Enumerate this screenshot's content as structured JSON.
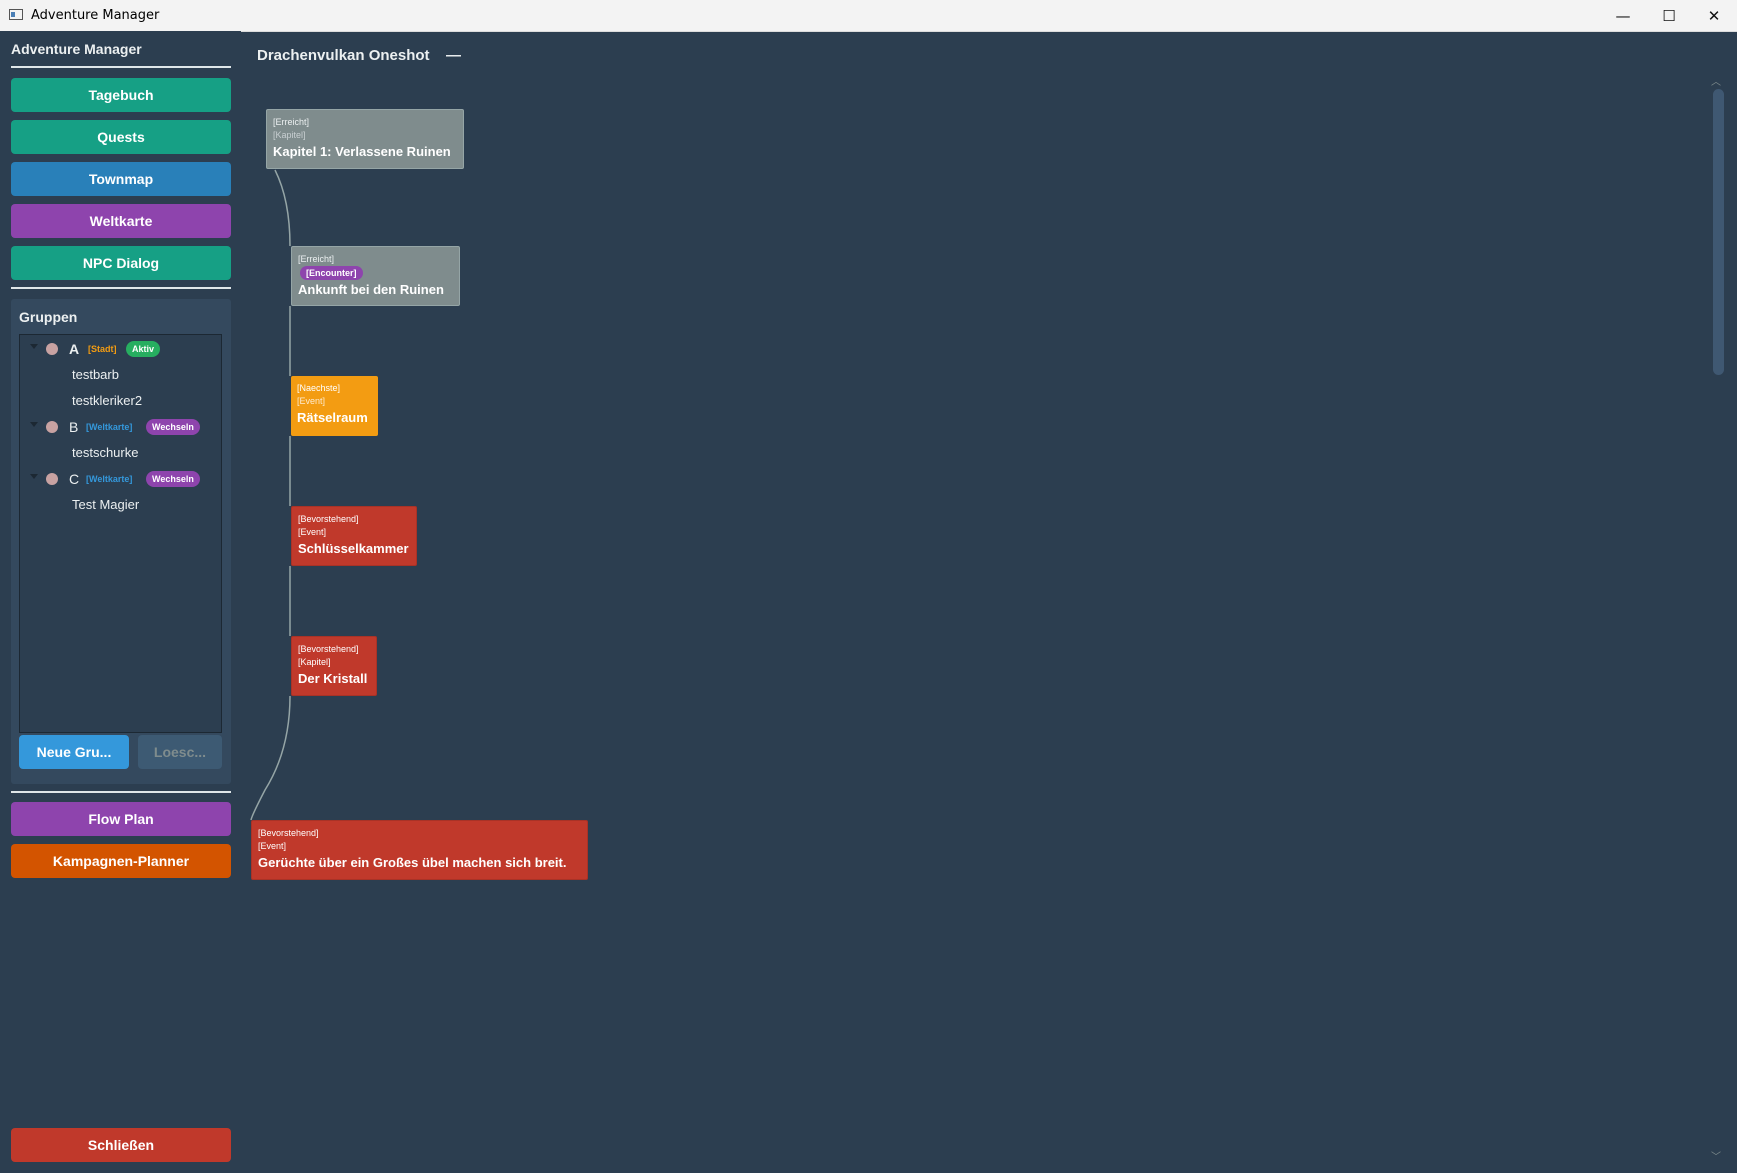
{
  "window": {
    "title": "Adventure Manager",
    "minimize_glyph": "—",
    "maximize_glyph": "☐",
    "close_glyph": "✕"
  },
  "sidebar": {
    "title": "Adventure Manager",
    "nav": [
      {
        "label": "Tagebuch",
        "color": "#16a085"
      },
      {
        "label": "Quests",
        "color": "#16a085"
      },
      {
        "label": "Townmap",
        "color": "#2980b9"
      },
      {
        "label": "Weltkarte",
        "color": "#8e44ad"
      },
      {
        "label": "NPC Dialog",
        "color": "#16a085"
      }
    ],
    "groups": {
      "title": "Gruppen",
      "items": [
        {
          "name": "A",
          "location": "[Stadt]",
          "badge": "Aktiv",
          "members": [
            "testbarb",
            "testkleriker2"
          ]
        },
        {
          "name": "B",
          "location": "[Weltkarte]",
          "badge": "Wechseln",
          "members": [
            "testschurke"
          ]
        },
        {
          "name": "C",
          "location": "[Weltkarte]",
          "badge": "Wechseln",
          "members": [
            "Test Magier"
          ]
        }
      ],
      "new_button": "Neue Gru...",
      "delete_button": "Loesc..."
    },
    "bottom_nav": [
      {
        "label": "Flow Plan",
        "color": "#8e44ad"
      },
      {
        "label": "Kampagnen-Planner",
        "color": "#d35400"
      }
    ],
    "close_button": "Schließen"
  },
  "main": {
    "title": "Drachenvulkan Oneshot",
    "collapse_glyph": "—",
    "nodes": [
      {
        "status": "[Erreicht]",
        "type": "[Kapitel]",
        "title": "Kapitel 1: Verlassene Ruinen",
        "color": "#7f8c8d"
      },
      {
        "status": "[Erreicht]",
        "type": "[Encounter]",
        "title": "Ankunft bei den Ruinen",
        "color": "#7f8c8d"
      },
      {
        "status": "[Naechste]",
        "type": "[Event]",
        "title": "Rätselraum",
        "color": "#f39c12"
      },
      {
        "status": "[Bevorstehend]",
        "type": "[Event]",
        "title": "Schlüsselkammer",
        "color": "#c0392b"
      },
      {
        "status": "[Bevorstehend]",
        "type": "[Kapitel]",
        "title": "Der Kristall",
        "color": "#c0392b"
      },
      {
        "status": "[Bevorstehend]",
        "type": "[Event]",
        "title": "Gerüchte über ein Großes übel machen sich breit.",
        "color": "#c0392b"
      }
    ]
  }
}
